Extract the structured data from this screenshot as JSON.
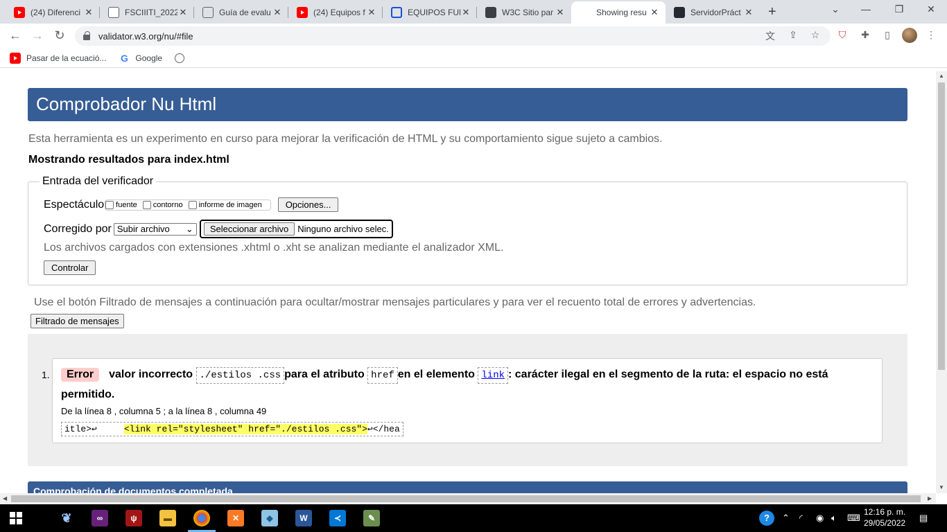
{
  "tabs": [
    {
      "title": "(24) Diferenci",
      "icon": "youtube-icon"
    },
    {
      "title": "FSCIIITI_2022",
      "icon": "image-icon"
    },
    {
      "title": "Guía de evalu",
      "icon": "globe-icon"
    },
    {
      "title": "(24) Equipos f",
      "icon": "youtube-icon"
    },
    {
      "title": "EQUIPOS FUN",
      "icon": "circle-logo-icon"
    },
    {
      "title": "W3C Sitio par",
      "icon": "w3c-icon"
    },
    {
      "title": "Showing resu",
      "icon": "nu-validator-icon",
      "active": true
    },
    {
      "title": "ServidorPráct",
      "icon": "github-icon"
    }
  ],
  "address": {
    "url": "validator.w3.org/nu/#file"
  },
  "bookmarks": [
    {
      "label": "Pasar de la ecuació...",
      "icon": "youtube-icon"
    },
    {
      "label": "Google",
      "icon": "google-icon"
    },
    {
      "label": "",
      "icon": "globe-icon"
    }
  ],
  "page": {
    "title": "Comprobador Nu Html",
    "intro": "Esta herramienta es un experimento en curso para mejorar la verificación de HTML y su comportamiento sigue sujeto a cambios.",
    "showing": "Mostrando resultados para index.html",
    "form": {
      "legend": "Entrada del verificador",
      "show_label": "Espectáculo",
      "checkboxes": [
        "fuente",
        "contorno",
        "informe de imagen"
      ],
      "options_button": "Opciones...",
      "checked_by_label": "Corregido por",
      "select_value": "Subir archivo",
      "file_button": "Seleccionar archivo",
      "file_status": "Ninguno archivo selec.",
      "note": "Los archivos cargados con extensiones .xhtml o .xht se analizan mediante el analizador XML.",
      "submit": "Controlar"
    },
    "filter_text": "Use el botón Filtrado de mensajes a continuación para ocultar/mostrar mensajes particulares y para ver el recuento total de errores y advertencias.",
    "filter_button": "Filtrado de mensajes",
    "messages": [
      {
        "number": "1.",
        "type": "Error",
        "part1": "valor incorrecto",
        "value": "./estilos .css",
        "part2": "para el atributo",
        "attribute": "href",
        "part3": "en el elemento",
        "element": "link",
        "part4": ": carácter ilegal en el segmento de la ruta: el espacio no está permitido.",
        "location": "De la línea 8 , columna 5 ; a la línea 8 , columna 49",
        "extract_before": "itle>↩     ",
        "extract_highlight": "<link rel=\"stylesheet\" href=\"./estilos .css\">",
        "extract_after": "↩</hea"
      }
    ],
    "done_bar": "Comprobación de documentos completada"
  },
  "taskbar": {
    "time": "12:16 p. m.",
    "date": "29/05/2022"
  }
}
